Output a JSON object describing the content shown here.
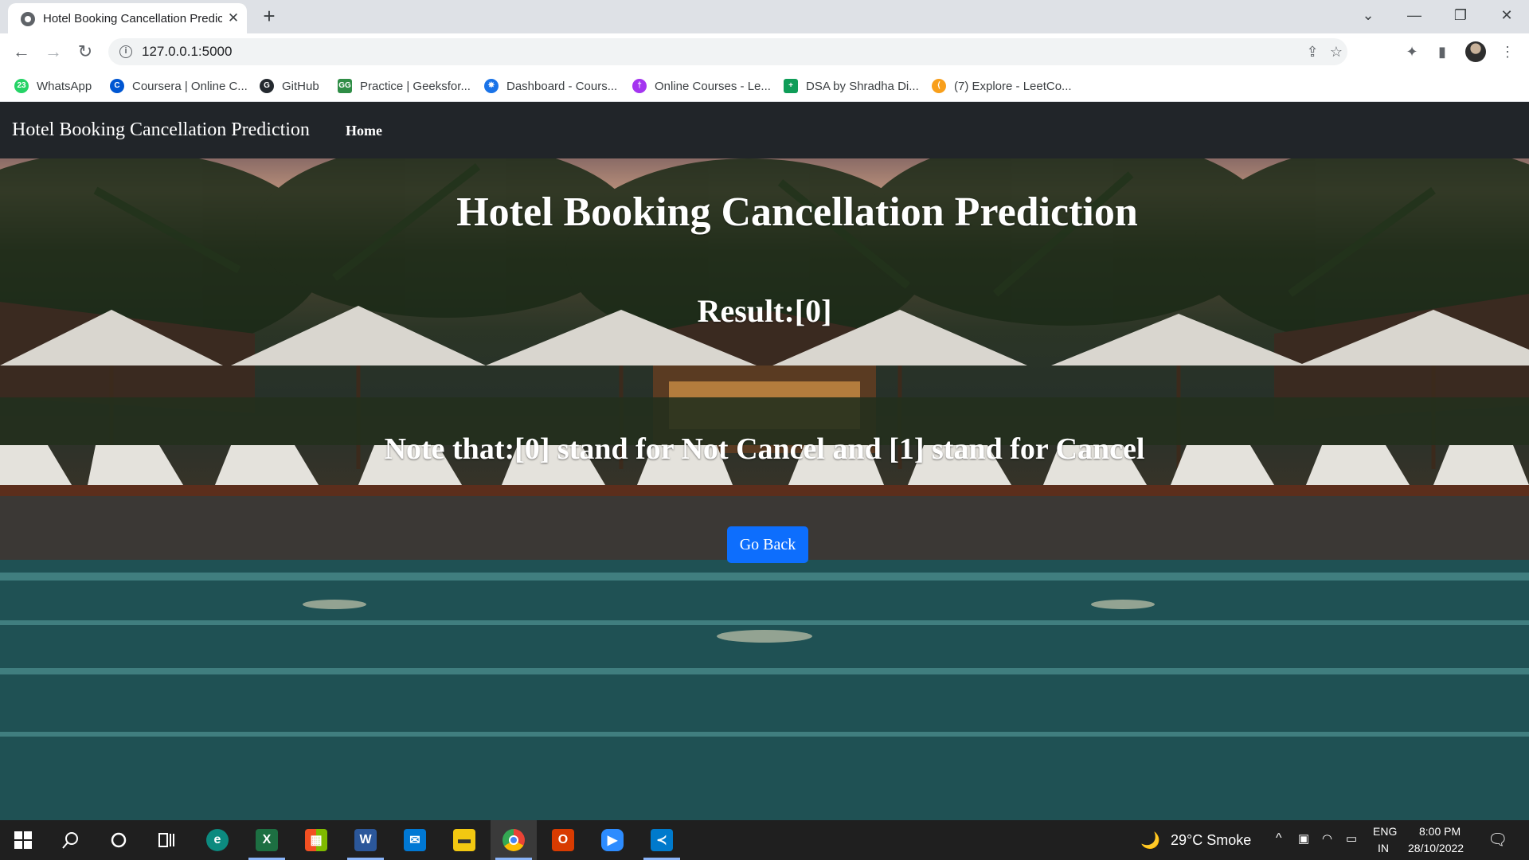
{
  "browser": {
    "tab_title": "Hotel Booking Cancellation Prediction",
    "url": "127.0.0.1:5000"
  },
  "bookmarks": [
    {
      "label": "WhatsApp",
      "icon": "whatsapp-icon",
      "color": "#25d366",
      "glyph": "23"
    },
    {
      "label": "Coursera | Online C...",
      "icon": "coursera-icon",
      "color": "#0056d2",
      "glyph": "C"
    },
    {
      "label": "GitHub",
      "icon": "github-icon",
      "color": "#24292f",
      "glyph": "G"
    },
    {
      "label": "Practice | Geeksfor...",
      "icon": "geeksforgeeks-icon",
      "color": "#2f8d46",
      "glyph": "GG"
    },
    {
      "label": "Dashboard - Cours...",
      "icon": "dashboard-icon",
      "color": "#1a73e8",
      "glyph": "✵"
    },
    {
      "label": "Online Courses - Le...",
      "icon": "online-courses-icon",
      "color": "#a435f0",
      "glyph": "†"
    },
    {
      "label": "DSA by Shradha Di...",
      "icon": "sheets-icon",
      "color": "#0f9d58",
      "glyph": "+"
    },
    {
      "label": "(7) Explore - LeetCo...",
      "icon": "leetcode-icon",
      "color": "#f89f1b",
      "glyph": "⟨"
    }
  ],
  "site": {
    "brand": "Hotel Booking Cancellation Prediction",
    "nav_home": "Home",
    "title": "Hotel Booking Cancellation Prediction",
    "result": "Result:[0]",
    "note": "Note that:[0] stand for Not Cancel and [1] stand for Cancel",
    "go_back": "Go Back"
  },
  "taskbar": {
    "weather": "29°C  Smoke",
    "lang_top": "ENG",
    "lang_bottom": "IN",
    "time": "8:00 PM",
    "date": "28/10/2022",
    "apps": [
      {
        "name": "edge-icon",
        "color": "#0c8a7f"
      },
      {
        "name": "excel-icon",
        "color": "#1d6f42"
      },
      {
        "name": "store-icon",
        "color": "#f25022"
      },
      {
        "name": "word-icon",
        "color": "#2b579a"
      },
      {
        "name": "mail-icon",
        "color": "#0078d4"
      },
      {
        "name": "file-explorer-icon",
        "color": "#f2c811"
      },
      {
        "name": "chrome-icon",
        "color": "#ea4335"
      },
      {
        "name": "office-icon",
        "color": "#d83b01"
      },
      {
        "name": "zoom-icon",
        "color": "#2d8cff"
      },
      {
        "name": "vscode-icon",
        "color": "#007acc"
      }
    ]
  }
}
